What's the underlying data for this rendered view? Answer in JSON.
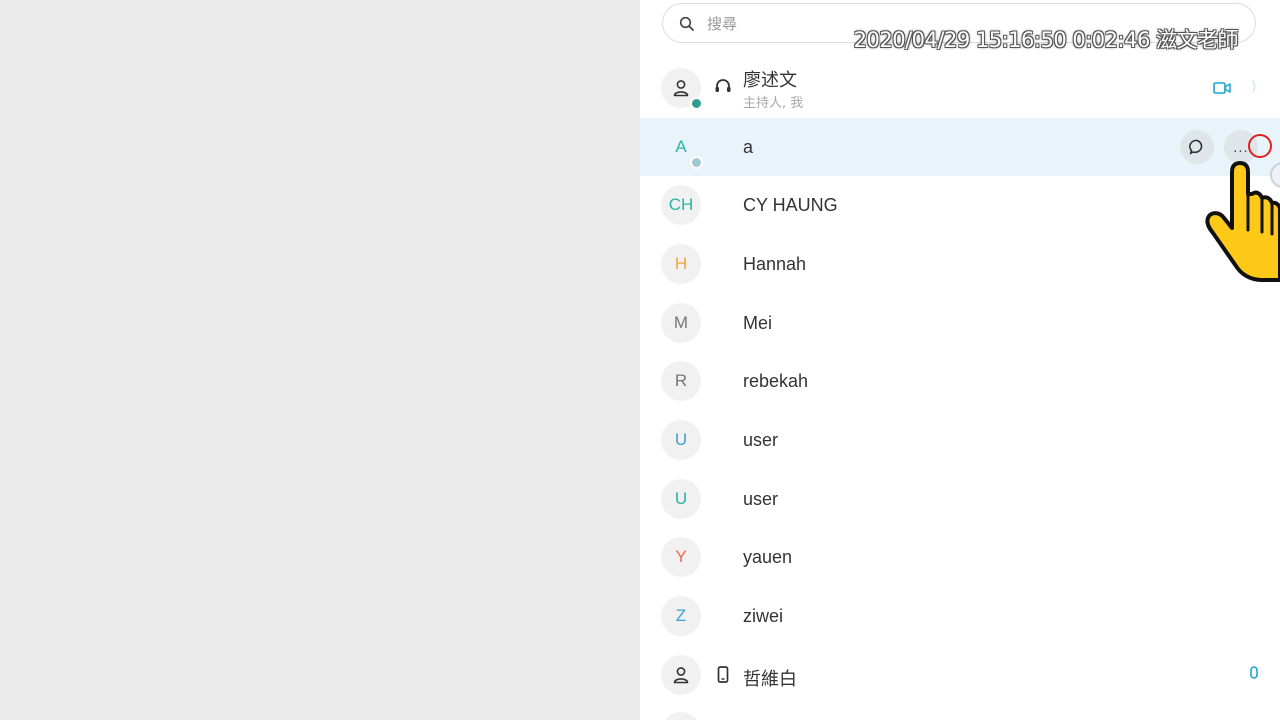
{
  "search": {
    "placeholder": "搜尋"
  },
  "overlay": {
    "timestamp": "2020/04/29 15:16:50 0:02:46 滋文老師"
  },
  "participants": [
    {
      "avatar_text": "",
      "avatar_color": "#333333",
      "name": "廖述文",
      "subtitle": "主持人, 我",
      "role_icon": "headset-icon",
      "status": "online",
      "right_icon": "video-camera-icon"
    },
    {
      "avatar_text": "A",
      "avatar_color": "#2bb3a3",
      "name": "a",
      "status": "online-light",
      "actions": {
        "chat_icon": "chat-bubble-icon",
        "more_label": "..."
      }
    },
    {
      "avatar_text": "CH",
      "avatar_color": "#2bb3a3",
      "name": "CY HAUNG"
    },
    {
      "avatar_text": "H",
      "avatar_color": "#f0a53a",
      "name": "Hannah"
    },
    {
      "avatar_text": "M",
      "avatar_color": "#777777",
      "name": "Mei"
    },
    {
      "avatar_text": "R",
      "avatar_color": "#777777",
      "name": "rebekah"
    },
    {
      "avatar_text": "U",
      "avatar_color": "#3c9fd6",
      "name": "user"
    },
    {
      "avatar_text": "U",
      "avatar_color": "#2bb3a3",
      "name": "user"
    },
    {
      "avatar_text": "Y",
      "avatar_color": "#ef6b4a",
      "name": "yauen"
    },
    {
      "avatar_text": "Z",
      "avatar_color": "#3c9fd6",
      "name": "ziwei"
    },
    {
      "avatar_text": "",
      "avatar_color": "#333333",
      "name": "哲維白",
      "role_icon": "phone-icon",
      "right_icon": "microphone-icon"
    }
  ],
  "colors": {
    "accent": "#1aa5d8",
    "hover_row": "#e8f4fa",
    "left_pane": "#ebebeb"
  }
}
